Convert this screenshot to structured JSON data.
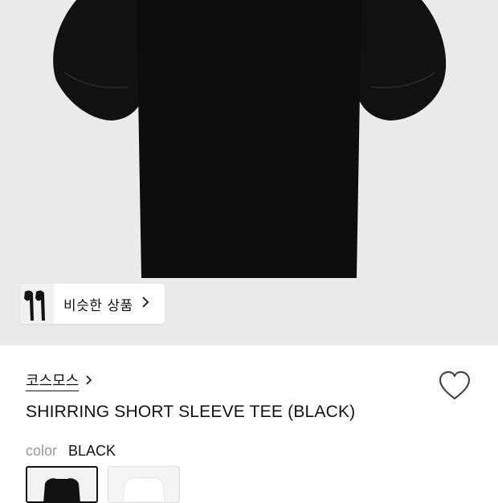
{
  "product_image": {
    "subject": "black shirring short sleeve tee",
    "background_color": "#ebebeb",
    "garment_color": "#0e0e0e"
  },
  "similar_products": {
    "label": "비슷한 상품",
    "icon": "chevron-right-icon"
  },
  "brand": {
    "name": "코스모스",
    "icon": "chevron-right-icon"
  },
  "wishlist": {
    "icon": "heart-outline-icon",
    "selected": false
  },
  "product": {
    "title": "SHIRRING SHORT SLEEVE TEE (BLACK)"
  },
  "color_option": {
    "label": "color",
    "value": "BLACK",
    "swatches": [
      {
        "name": "BLACK",
        "selected": true,
        "color": "#111111"
      },
      {
        "name": "WHITE",
        "selected": false,
        "color": "#ffffff"
      }
    ]
  }
}
